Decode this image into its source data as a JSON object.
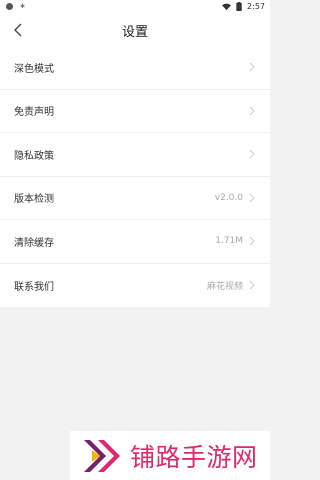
{
  "status_bar": {
    "time": "2:57",
    "left_icons": [
      "dot-icon",
      "settings-dot-icon"
    ],
    "right_icons": [
      "wifi-icon",
      "battery-icon"
    ]
  },
  "header": {
    "title": "设置",
    "back_icon": "chevron-left-icon"
  },
  "settings": [
    {
      "label": "深色模式",
      "value": ""
    },
    {
      "label": "免责声明",
      "value": ""
    },
    {
      "label": "隐私政策",
      "value": ""
    },
    {
      "label": "版本检测",
      "value": "v2.0.0"
    },
    {
      "label": "清除缓存",
      "value": "1.71M"
    },
    {
      "label": "联系我们",
      "value": "麻花视频"
    }
  ],
  "watermark": {
    "text": "铺路手游网",
    "color": "#e0286e"
  },
  "colors": {
    "background": "#f2f2f2",
    "row_background": "#ffffff",
    "value_text": "#aaaaaa"
  }
}
